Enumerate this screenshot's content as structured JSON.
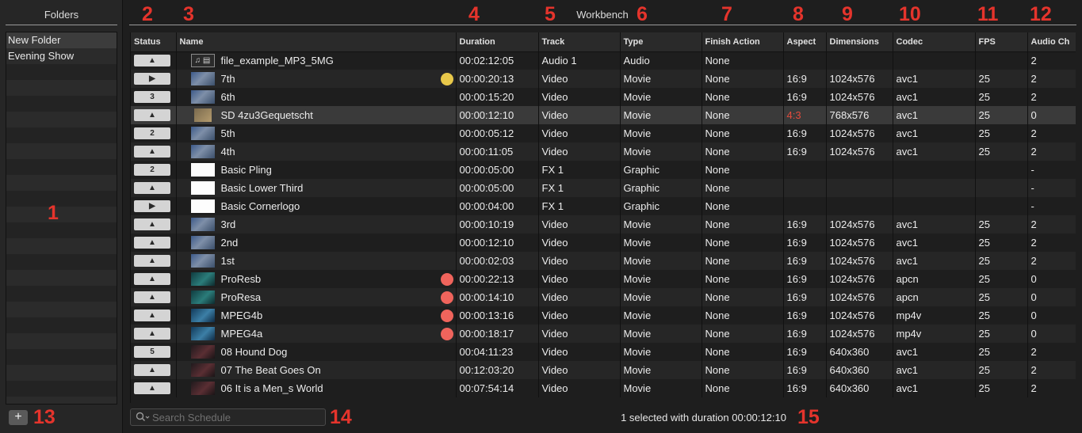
{
  "folders": {
    "title": "Folders",
    "items": [
      "New Folder",
      "Evening Show"
    ],
    "add_button_label": "+"
  },
  "workbench": {
    "title": "Workbench",
    "columns": [
      "Status",
      "Name",
      "Duration",
      "Track",
      "Type",
      "Finish Action",
      "Aspect",
      "Dimensions",
      "Codec",
      "FPS",
      "Audio Ch"
    ],
    "rows": [
      {
        "status": "▲",
        "thumb": "audio",
        "name": "file_example_MP3_5MG",
        "dot": "",
        "duration": "00:02:12:05",
        "track": "Audio 1",
        "type": "Audio",
        "finish": "None",
        "aspect": "",
        "dimensions": "",
        "codec": "",
        "fps": "",
        "audio": "2"
      },
      {
        "status": "▶",
        "thumb": "video",
        "name": "7th",
        "dot": "yellow",
        "duration": "00:00:20:13",
        "track": "Video",
        "type": "Movie",
        "finish": "None",
        "aspect": "16:9",
        "dimensions": "1024x576",
        "codec": "avc1",
        "fps": "25",
        "audio": "2"
      },
      {
        "status": "3",
        "thumb": "video",
        "name": "6th",
        "dot": "",
        "duration": "00:00:15:20",
        "track": "Video",
        "type": "Movie",
        "finish": "None",
        "aspect": "16:9",
        "dimensions": "1024x576",
        "codec": "avc1",
        "fps": "25",
        "audio": "2"
      },
      {
        "status": "▲",
        "thumb": "video-small",
        "name": "SD 4zu3Gequetscht",
        "dot": "",
        "duration": "00:00:12:10",
        "track": "Video",
        "type": "Movie",
        "finish": "None",
        "aspect": "4:3",
        "aspect_warn": true,
        "dimensions": "768x576",
        "codec": "avc1",
        "fps": "25",
        "audio": "0",
        "selected": true
      },
      {
        "status": "2",
        "thumb": "video",
        "name": "5th",
        "dot": "",
        "duration": "00:00:05:12",
        "track": "Video",
        "type": "Movie",
        "finish": "None",
        "aspect": "16:9",
        "dimensions": "1024x576",
        "codec": "avc1",
        "fps": "25",
        "audio": "2"
      },
      {
        "status": "▲",
        "thumb": "video",
        "name": "4th",
        "dot": "",
        "duration": "00:00:11:05",
        "track": "Video",
        "type": "Movie",
        "finish": "None",
        "aspect": "16:9",
        "dimensions": "1024x576",
        "codec": "avc1",
        "fps": "25",
        "audio": "2"
      },
      {
        "status": "2",
        "thumb": "graphic",
        "name": "Basic Pling",
        "dot": "",
        "duration": "00:00:05:00",
        "track": "FX 1",
        "type": "Graphic",
        "finish": "None",
        "aspect": "",
        "dimensions": "",
        "codec": "",
        "fps": "",
        "audio": "-"
      },
      {
        "status": "▲",
        "thumb": "graphic",
        "name": "Basic Lower Third",
        "dot": "",
        "duration": "00:00:05:00",
        "track": "FX 1",
        "type": "Graphic",
        "finish": "None",
        "aspect": "",
        "dimensions": "",
        "codec": "",
        "fps": "",
        "audio": "-"
      },
      {
        "status": "▶",
        "thumb": "graphic",
        "name": "Basic Cornerlogo",
        "dot": "",
        "duration": "00:00:04:00",
        "track": "FX 1",
        "type": "Graphic",
        "finish": "None",
        "aspect": "",
        "dimensions": "",
        "codec": "",
        "fps": "",
        "audio": "-"
      },
      {
        "status": "▲",
        "thumb": "video",
        "name": "3rd",
        "dot": "",
        "duration": "00:00:10:19",
        "track": "Video",
        "type": "Movie",
        "finish": "None",
        "aspect": "16:9",
        "dimensions": "1024x576",
        "codec": "avc1",
        "fps": "25",
        "audio": "2"
      },
      {
        "status": "▲",
        "thumb": "video",
        "name": "2nd",
        "dot": "",
        "duration": "00:00:12:10",
        "track": "Video",
        "type": "Movie",
        "finish": "None",
        "aspect": "16:9",
        "dimensions": "1024x576",
        "codec": "avc1",
        "fps": "25",
        "audio": "2"
      },
      {
        "status": "▲",
        "thumb": "video",
        "name": "1st",
        "dot": "",
        "duration": "00:00:02:03",
        "track": "Video",
        "type": "Movie",
        "finish": "None",
        "aspect": "16:9",
        "dimensions": "1024x576",
        "codec": "avc1",
        "fps": "25",
        "audio": "2"
      },
      {
        "status": "▲",
        "thumb": "video-teal",
        "name": "ProResb",
        "dot": "red",
        "duration": "00:00:22:13",
        "track": "Video",
        "type": "Movie",
        "finish": "None",
        "aspect": "16:9",
        "dimensions": "1024x576",
        "codec": "apcn",
        "fps": "25",
        "audio": "0"
      },
      {
        "status": "▲",
        "thumb": "video-teal",
        "name": "ProResa",
        "dot": "red",
        "duration": "00:00:14:10",
        "track": "Video",
        "type": "Movie",
        "finish": "None",
        "aspect": "16:9",
        "dimensions": "1024x576",
        "codec": "apcn",
        "fps": "25",
        "audio": "0"
      },
      {
        "status": "▲",
        "thumb": "video-blue",
        "name": "MPEG4b",
        "dot": "red",
        "duration": "00:00:13:16",
        "track": "Video",
        "type": "Movie",
        "finish": "None",
        "aspect": "16:9",
        "dimensions": "1024x576",
        "codec": "mp4v",
        "fps": "25",
        "audio": "0"
      },
      {
        "status": "▲",
        "thumb": "video-blue",
        "name": "MPEG4a",
        "dot": "red",
        "duration": "00:00:18:17",
        "track": "Video",
        "type": "Movie",
        "finish": "None",
        "aspect": "16:9",
        "dimensions": "1024x576",
        "codec": "mp4v",
        "fps": "25",
        "audio": "0"
      },
      {
        "status": "5",
        "thumb": "video-dark",
        "name": "08 Hound Dog",
        "dot": "",
        "duration": "00:04:11:23",
        "track": "Video",
        "type": "Movie",
        "finish": "None",
        "aspect": "16:9",
        "dimensions": "640x360",
        "codec": "avc1",
        "fps": "25",
        "audio": "2"
      },
      {
        "status": "▲",
        "thumb": "video-dark",
        "name": "07 The Beat Goes On",
        "dot": "",
        "duration": "00:12:03:20",
        "track": "Video",
        "type": "Movie",
        "finish": "None",
        "aspect": "16:9",
        "dimensions": "640x360",
        "codec": "avc1",
        "fps": "25",
        "audio": "2"
      },
      {
        "status": "▲",
        "thumb": "video-dark",
        "name": "06 It is a Men_s World",
        "dot": "",
        "duration": "00:07:54:14",
        "track": "Video",
        "type": "Movie",
        "finish": "None",
        "aspect": "16:9",
        "dimensions": "640x360",
        "codec": "avc1",
        "fps": "25",
        "audio": "2"
      }
    ]
  },
  "search": {
    "placeholder": "Search Schedule",
    "value": ""
  },
  "status_bar": {
    "text": "1 selected with duration 00:00:12:10"
  },
  "annotations": [
    "1",
    "2",
    "3",
    "4",
    "5",
    "6",
    "7",
    "8",
    "9",
    "10",
    "11",
    "12",
    "13",
    "14",
    "15"
  ],
  "colors": {
    "accent_red": "#e5342c",
    "dot_yellow": "#e8c84a",
    "dot_red": "#f0645c",
    "aspect_warning": "#e54b3c"
  },
  "icons": {
    "search": "search-icon",
    "add": "plus-icon",
    "audio_file": "audio-file-icon"
  }
}
